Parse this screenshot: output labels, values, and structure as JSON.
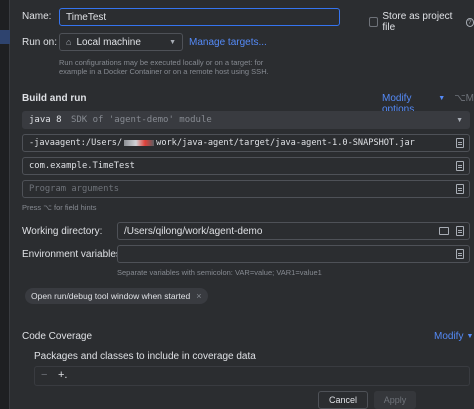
{
  "name_label": "Name:",
  "name_value": "TimeTest",
  "store_label": "Store as project file",
  "run_on": {
    "label": "Run on:",
    "value": "Local machine",
    "manage_link": "Manage targets...",
    "hint_line1": "Run configurations may be executed locally or on a target: for",
    "hint_line2": "example in a Docker Container or on a remote host using SSH."
  },
  "build_run": {
    "title": "Build and run",
    "modify_label": "Modify options",
    "modify_shortcut": "⌥M",
    "jdk_name": "java 8",
    "jdk_desc": "SDK of 'agent-demo' module",
    "vm_options": "-javaagent:/Users/",
    "vm_options_tail": "work/java-agent/target/java-agent-1.0-SNAPSHOT.jar",
    "main_class": "com.example.TimeTest",
    "program_args_placeholder": "Program arguments",
    "field_hints": "Press ⌥ for field hints"
  },
  "working_dir": {
    "label": "Working directory:",
    "value": "/Users/qilong/work/agent-demo"
  },
  "env_vars": {
    "label": "Environment variables:",
    "hint": "Separate variables with semicolon: VAR=value; VAR1=value1"
  },
  "chip_label": "Open run/debug tool window when started",
  "chip_close": "×",
  "coverage": {
    "title": "Code Coverage",
    "modify_label": "Modify",
    "packages_label": "Packages and classes to include in coverage data",
    "minus": "−",
    "plus": "+."
  },
  "buttons": {
    "cancel": "Cancel",
    "apply": "Apply"
  },
  "colors": {
    "background": "#2b2d30",
    "accent": "#3574f0",
    "link": "#548af7"
  }
}
